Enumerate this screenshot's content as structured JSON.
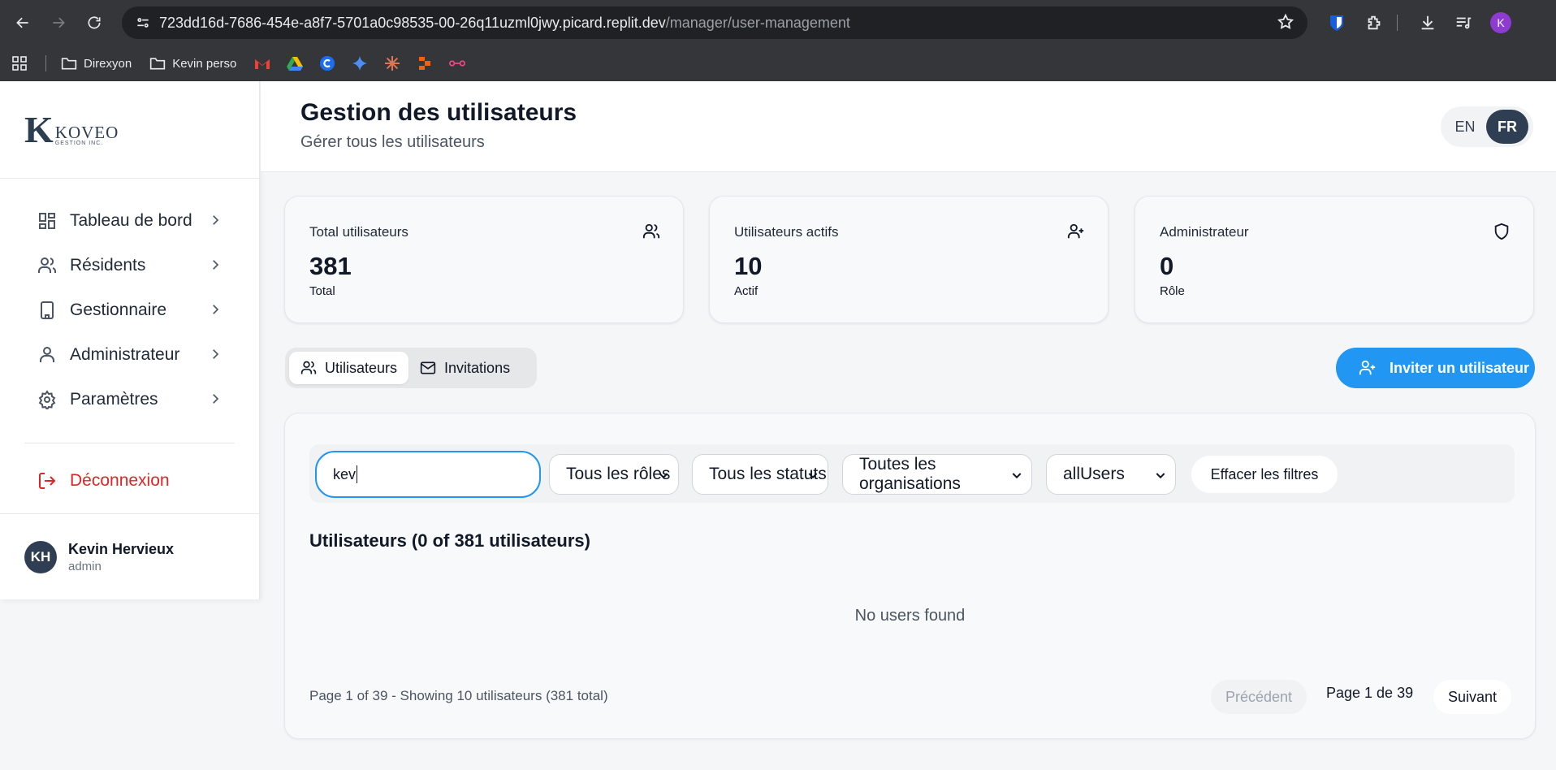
{
  "browser": {
    "url_host": "723dd16d-7686-454e-a8f7-5701a0c98535-00-26q11uzml0jwy.picard.replit.dev",
    "url_path": "/manager/user-management",
    "profile_initial": "K",
    "bookmarks": [
      {
        "label": "Direxyon",
        "icon": "folder-icon"
      },
      {
        "label": "Kevin perso",
        "icon": "folder-icon"
      }
    ]
  },
  "sidebar": {
    "logo_main": "KOVEO",
    "logo_sub": "GESTION INC.",
    "items": [
      {
        "label": "Tableau de bord",
        "icon": "dashboard-icon"
      },
      {
        "label": "Résidents",
        "icon": "users-icon"
      },
      {
        "label": "Gestionnaire",
        "icon": "building-icon"
      },
      {
        "label": "Administrateur",
        "icon": "user-icon"
      },
      {
        "label": "Paramètres",
        "icon": "gear-icon"
      }
    ],
    "logout_label": "Déconnexion",
    "user": {
      "initials": "KH",
      "name": "Kevin Hervieux",
      "role": "admin"
    }
  },
  "header": {
    "title": "Gestion des utilisateurs",
    "subtitle": "Gérer tous les utilisateurs",
    "lang_en": "EN",
    "lang_fr": "FR",
    "active_lang": "FR"
  },
  "stats": [
    {
      "label": "Total utilisateurs",
      "value": "381",
      "sub": "Total",
      "icon": "users-icon"
    },
    {
      "label": "Utilisateurs actifs",
      "value": "10",
      "sub": "Actif",
      "icon": "user-plus-icon"
    },
    {
      "label": "Administrateur",
      "value": "0",
      "sub": "Rôle",
      "icon": "shield-icon"
    }
  ],
  "tabs": {
    "users": "Utilisateurs",
    "invitations": "Invitations"
  },
  "invite_label": "Inviter un utilisateur",
  "filters": {
    "search_value": "kev",
    "role": "Tous les rôles",
    "status": "Tous les statuts",
    "organization": "Toutes les organisations",
    "scope": "allUsers",
    "clear_label": "Effacer les filtres"
  },
  "list": {
    "title": "Utilisateurs (0 of 381 utilisateurs)",
    "empty": "No users found",
    "pager_info": "Page 1 of 39 - Showing 10 utilisateurs (381 total)",
    "prev_label": "Précédent",
    "page_label": "Page 1 de 39",
    "next_label": "Suivant"
  },
  "colors": {
    "accent": "#2196f3",
    "danger": "#dc2626",
    "dark": "#2f3e53"
  }
}
